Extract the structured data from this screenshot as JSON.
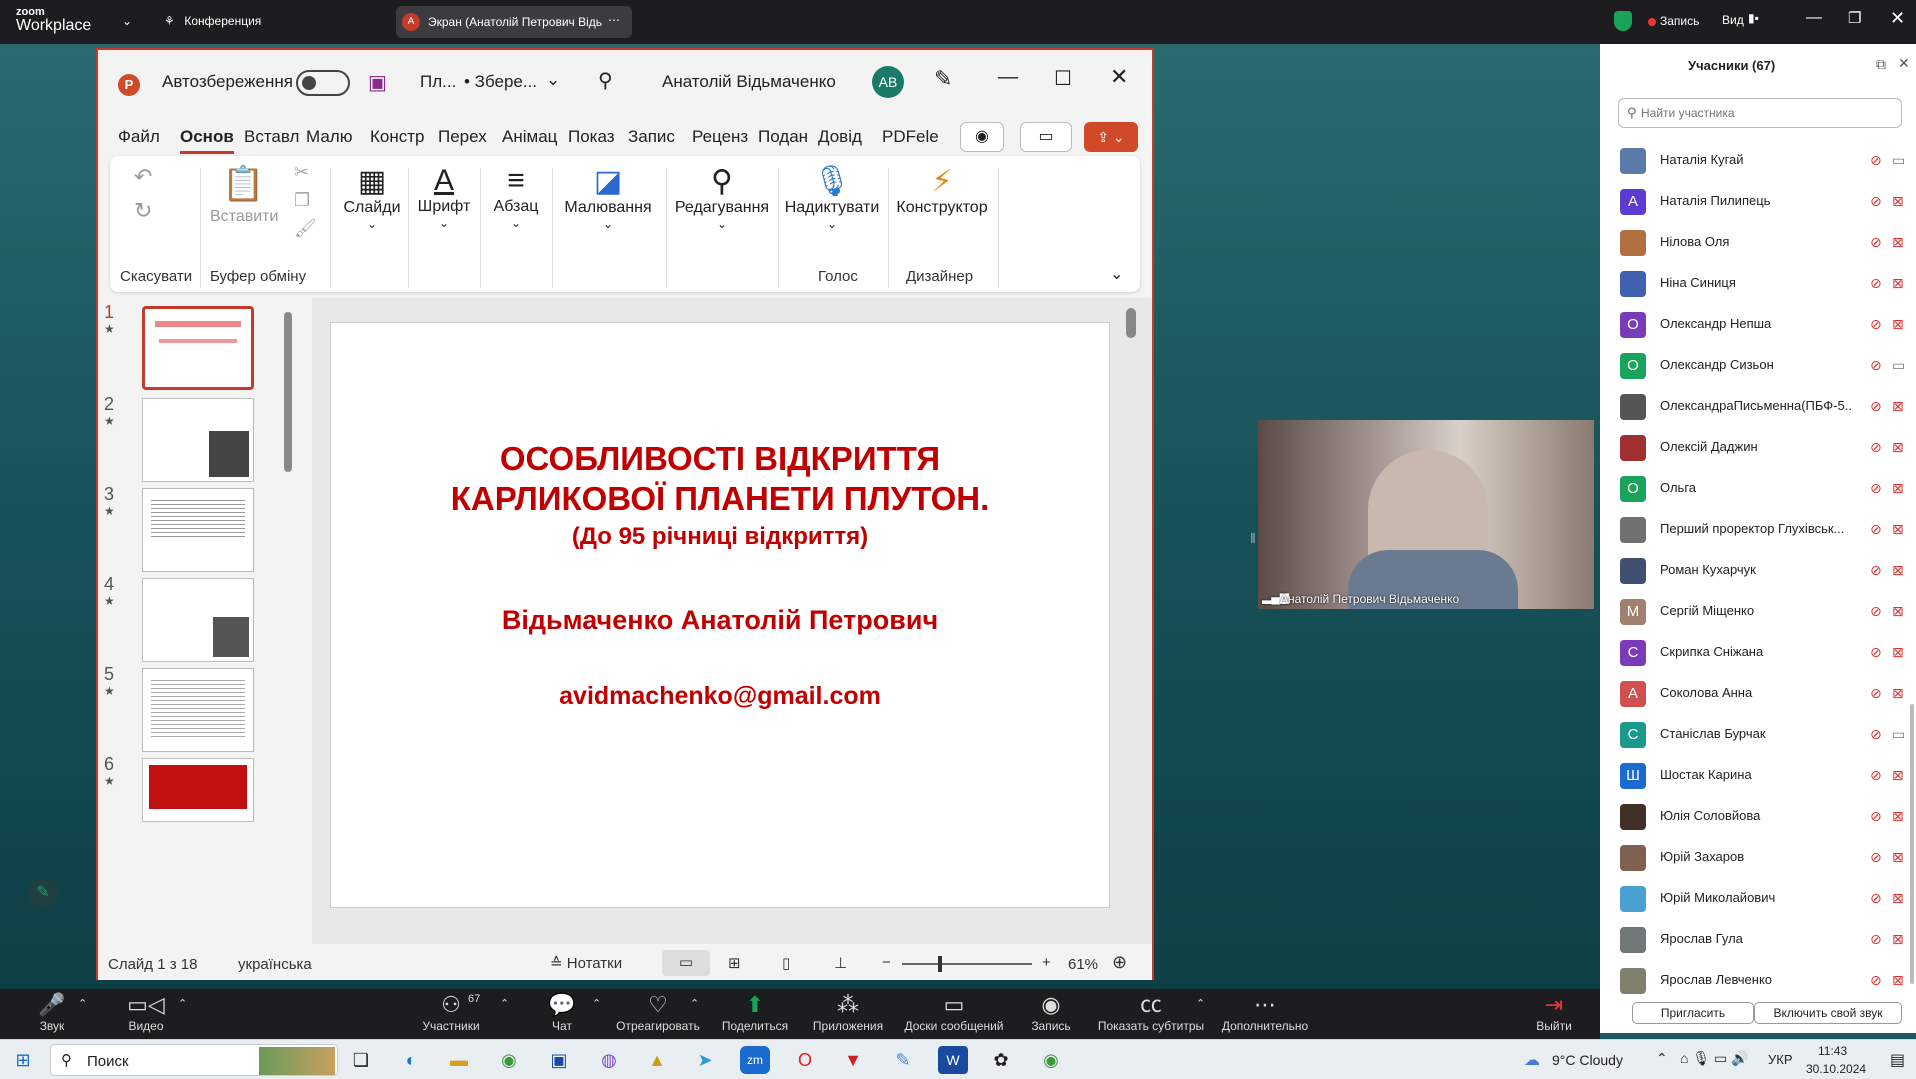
{
  "zoom": {
    "logo_top": "zoom",
    "logo_bottom": "Workplace",
    "meeting_label": "Конференция",
    "screen_tab": "Экран (Анатолій Петрович Відь",
    "screen_tab_letter": "А",
    "record": "Запись",
    "view": "Вид"
  },
  "ppt": {
    "autosave": "Автозбереження",
    "filename": "Пл...",
    "saved": "• Збере...",
    "user": "Анатолій Відьмаченко",
    "user_initials": "АВ",
    "menu": [
      "Файл",
      "Основ",
      "Вставл",
      "Малю",
      "Констр",
      "Перех",
      "Анімац",
      "Показ",
      "Запис",
      "Реценз",
      "Подан",
      "Довід",
      "PDFele"
    ],
    "ribbon": {
      "undo": "Скасувати",
      "clipboard": "Буфер обміну",
      "paste": "Вставити",
      "slides": "Слайди",
      "font": "Шрифт",
      "paragraph": "Абзац",
      "drawing": "Малювання",
      "editing": "Редагування",
      "dictate": "Надиктувати",
      "designer": "Конструктор",
      "voice": "Голос",
      "designer_group": "Дизайнер"
    },
    "thumb_numbers": [
      "1",
      "2",
      "3",
      "4",
      "5",
      "6"
    ],
    "slide": {
      "title1": "ОСОБЛИВОСТІ ВІДКРИТТЯ",
      "title2": "КАРЛИКОВОЇ ПЛАНЕТИ ПЛУТОН.",
      "subtitle": "(До 95 річниці відкриття)",
      "author": "Відьмаченко Анатолій Петрович",
      "email": "avidmachenko@gmail.com"
    },
    "status": {
      "slide": "Слайд 1 з 18",
      "lang": "українська",
      "notes": "Нотатки",
      "zoom": "61%"
    }
  },
  "video": {
    "name": "Анатолій Петрович Відьмаченко"
  },
  "participants": {
    "title": "Учасники (67)",
    "search_placeholder": "Найти участника",
    "invite": "Пригласить",
    "unmute_me": "Включить свой звук",
    "list": [
      {
        "name": "Наталія Кугай",
        "letter": "",
        "color": "#5b7aa8",
        "cam": "on"
      },
      {
        "name": "Наталія Пилипець",
        "letter": "А",
        "color": "#5b3bd1",
        "cam": "off"
      },
      {
        "name": "Нілова Оля",
        "letter": "",
        "color": "#b07040",
        "cam": "off"
      },
      {
        "name": "Ніна Синиця",
        "letter": "",
        "color": "#4060b0",
        "cam": "off"
      },
      {
        "name": "Олександр Непша",
        "letter": "О",
        "color": "#7a3bb8",
        "cam": "off"
      },
      {
        "name": "Олександр Сизьон",
        "letter": "О",
        "color": "#1aa35a",
        "cam": "on"
      },
      {
        "name": "ОлександраПисьменна(ПБФ-5...",
        "letter": "",
        "color": "#555555",
        "cam": "off"
      },
      {
        "name": "Олексій Даджин",
        "letter": "",
        "color": "#a03030",
        "cam": "off"
      },
      {
        "name": "Ольга",
        "letter": "О",
        "color": "#1aa35a",
        "cam": "off"
      },
      {
        "name": "Перший проректор Глухівськ...",
        "letter": "",
        "color": "#707070",
        "cam": "off"
      },
      {
        "name": "Роман Кухарчук",
        "letter": "",
        "color": "#405070",
        "cam": "off"
      },
      {
        "name": "Сергій Міщенко",
        "letter": "М",
        "color": "#a08070",
        "cam": "off"
      },
      {
        "name": "Скрипка Сніжана",
        "letter": "С",
        "color": "#7a3bb8",
        "cam": "off"
      },
      {
        "name": "Соколова Анна",
        "letter": "А",
        "color": "#d05050",
        "cam": "off"
      },
      {
        "name": "Станіслав Бурчак",
        "letter": "С",
        "color": "#1a9a8a",
        "cam": "on"
      },
      {
        "name": "Шостак  Карина",
        "letter": "Ш",
        "color": "#1a6ad0",
        "cam": "off"
      },
      {
        "name": "Юлія Соловйова",
        "letter": "",
        "color": "#403028",
        "cam": "off"
      },
      {
        "name": "Юрій Захаров",
        "letter": "",
        "color": "#806050",
        "cam": "off"
      },
      {
        "name": "Юрій Миколайович",
        "letter": "",
        "color": "#4aa0d0",
        "cam": "off"
      },
      {
        "name": "Ярослав Гула",
        "letter": "",
        "color": "#707878",
        "cam": "off"
      },
      {
        "name": "Ярослав Левченко",
        "letter": "",
        "color": "#808070",
        "cam": "off"
      }
    ]
  },
  "toolbar": {
    "sound": "Звук",
    "video": "Видео",
    "participants": "Участники",
    "participants_count": "67",
    "chat": "Чат",
    "react": "Отреагировать",
    "share": "Поделиться",
    "apps": "Приложения",
    "boards": "Доски сообщений",
    "record": "Запись",
    "captions": "Показать субтитры",
    "more": "Дополнительно",
    "leave": "Выйти"
  },
  "taskbar": {
    "search": "Поиск",
    "weather": "9°C  Cloudy",
    "lang": "УКР",
    "time": "11:43",
    "date": "30.10.2024"
  }
}
